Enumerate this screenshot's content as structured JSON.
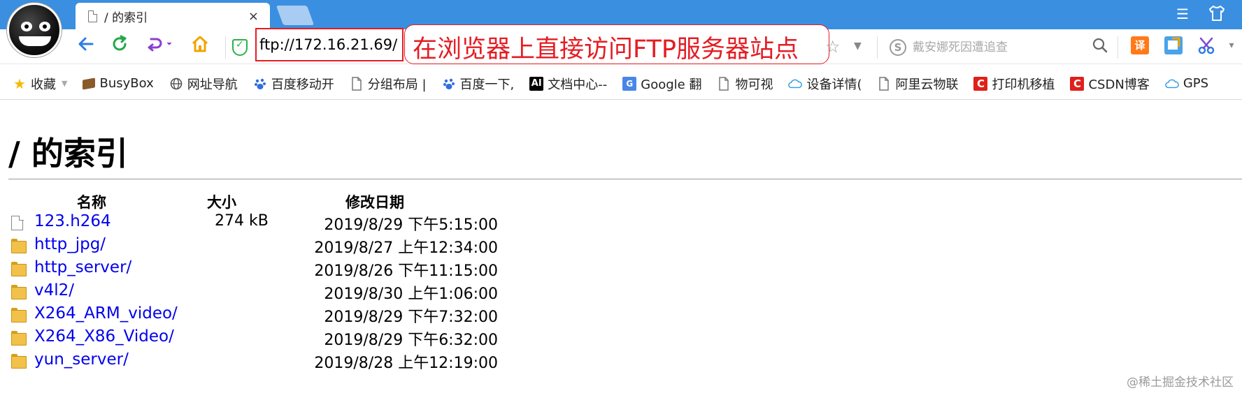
{
  "browser": {
    "tab_title": "/ 的索引",
    "tab_close": "×",
    "url": "ftp://172.16.21.69/",
    "callout": "在浏览器上直接访问FTP服务器站点",
    "search_placeholder": "戴安娜死因遭追查",
    "ext_translate": "译"
  },
  "bookmarks": [
    {
      "label": "收藏",
      "icon": "star-icon",
      "color": "#f5b800"
    },
    {
      "label": "BusyBox",
      "icon": "busybox-icon",
      "color": "#8a5a2b"
    },
    {
      "label": "网址导航",
      "icon": "globe-icon",
      "color": "#555555"
    },
    {
      "label": "百度移动开",
      "icon": "baidu-icon",
      "color": "#2f6fe0"
    },
    {
      "label": "分组布局 |",
      "icon": "page-icon",
      "color": "#777777"
    },
    {
      "label": "百度一下,",
      "icon": "baidu-icon",
      "color": "#2f6fe0"
    },
    {
      "label": "文档中心--",
      "icon": "ai-icon",
      "color": "#000000"
    },
    {
      "label": "Google 翻",
      "icon": "google-translate-icon",
      "color": "#4a86e8"
    },
    {
      "label": "物可视",
      "icon": "page-icon",
      "color": "#777777"
    },
    {
      "label": "设备详情(",
      "icon": "cloud-icon",
      "color": "#2f9be0"
    },
    {
      "label": "阿里云物联",
      "icon": "page-icon",
      "color": "#777777"
    },
    {
      "label": "打印机移植",
      "icon": "csdn-icon",
      "color": "#e0201a"
    },
    {
      "label": "CSDN博客",
      "icon": "csdn-icon",
      "color": "#e0201a"
    },
    {
      "label": "GPS",
      "icon": "cloud-icon",
      "color": "#2f9be0"
    }
  ],
  "page": {
    "title": "/ 的索引",
    "columns": {
      "name": "名称",
      "size": "大小",
      "modified": "修改日期"
    },
    "entries": [
      {
        "name": "123.h264",
        "size": "274 kB",
        "date": "2019/8/29 下午5:15:00",
        "type": "file"
      },
      {
        "name": "http_jpg/",
        "size": "",
        "date": "2019/8/27 上午12:34:00",
        "type": "folder"
      },
      {
        "name": "http_server/",
        "size": "",
        "date": "2019/8/26 下午11:15:00",
        "type": "folder"
      },
      {
        "name": "v4l2/",
        "size": "",
        "date": "2019/8/30 上午1:06:00",
        "type": "folder"
      },
      {
        "name": "X264_ARM_video/",
        "size": "",
        "date": "2019/8/29 下午7:32:00",
        "type": "folder"
      },
      {
        "name": "X264_X86_Video/",
        "size": "",
        "date": "2019/8/29 下午6:32:00",
        "type": "folder"
      },
      {
        "name": "yun_server/",
        "size": "",
        "date": "2019/8/28 上午12:19:00",
        "type": "folder"
      }
    ]
  },
  "watermark": "@稀土掘金技术社区"
}
